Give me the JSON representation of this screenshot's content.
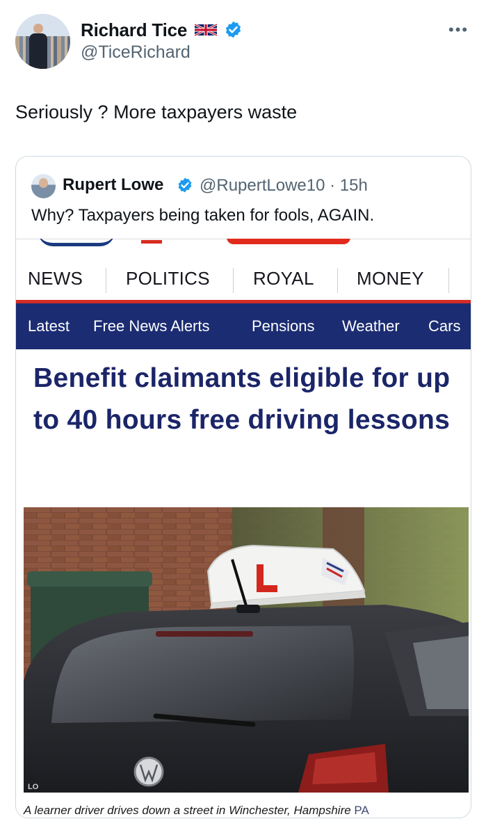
{
  "tweet": {
    "author_name": "Richard Tice",
    "author_handle": "@TiceRichard",
    "text": "Seriously ? More taxpayers waste"
  },
  "quoted": {
    "author_name": "Rupert Lowe",
    "author_handle": "@RupertLowe10 · 15h",
    "text": "Why? Taxpayers being taken for fools, AGAIN."
  },
  "article": {
    "main_nav": [
      "NEWS",
      "POLITICS",
      "ROYAL",
      "MONEY"
    ],
    "sub_nav": [
      "Latest",
      "Free News Alerts",
      "Pensions",
      "Weather",
      "Cars"
    ],
    "headline": "Benefit claimants eligible for up to 40 hours free driving lessons",
    "caption": "A learner driver drives down a street in Winchester, Hampshire",
    "caption_credit": "PA",
    "roof_sign_letter": "L",
    "badge_text": "LO"
  },
  "colors": {
    "verified_blue": "#1d9bf0",
    "nav_navy": "#1b2c72",
    "accent_red": "#d22d25",
    "headline_navy": "#1b2568",
    "muted_text": "#536471"
  },
  "icons": [
    "uk-flag-icon",
    "verified-badge-icon",
    "more-options-icon"
  ]
}
